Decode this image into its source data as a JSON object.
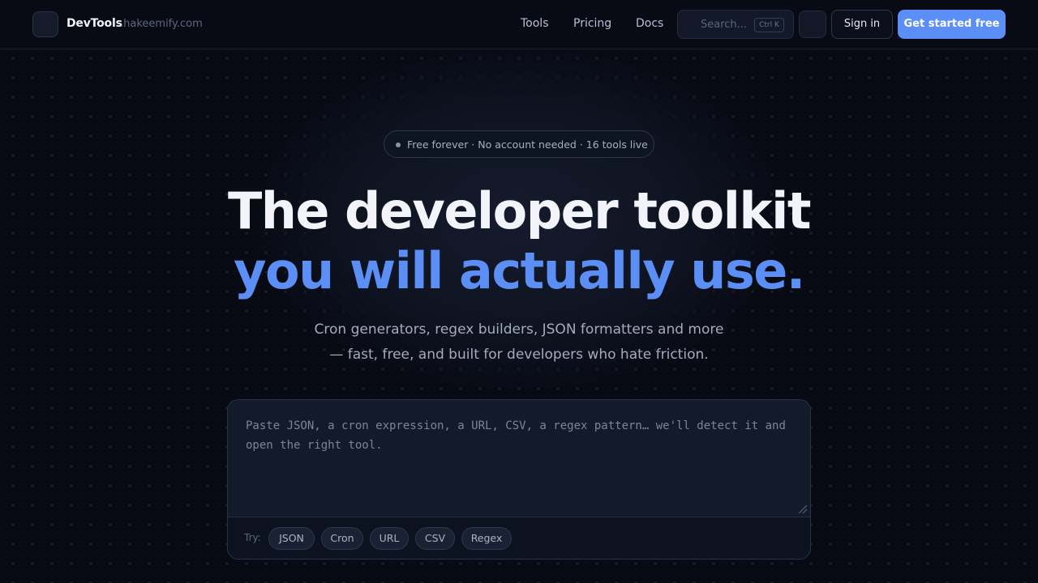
{
  "header": {
    "brand": "DevTools",
    "domain": ".hakeemify.com",
    "nav": [
      "Tools",
      "Pricing",
      "Docs"
    ],
    "search_placeholder": "Search...",
    "search_shortcut": "Ctrl K",
    "signin_label": "Sign in",
    "cta_label": "Get started free"
  },
  "hero": {
    "badge": "Free forever · No account needed · 16 tools live",
    "title_line1": "The developer toolkit",
    "title_line2": "you will actually use.",
    "subtitle_line1": "Cron generators, regex builders, JSON formatters and more",
    "subtitle_line2": "— fast, free, and built for developers who hate friction."
  },
  "input_panel": {
    "placeholder": "Paste JSON, a cron expression, a URL, CSV, a regex pattern… we'll detect it and open the right tool.",
    "try_label": "Try:",
    "chips": [
      "JSON",
      "Cron",
      "URL",
      "CSV",
      "Regex"
    ]
  },
  "colors": {
    "accent": "#5b8ff5",
    "background": "#080b14"
  }
}
